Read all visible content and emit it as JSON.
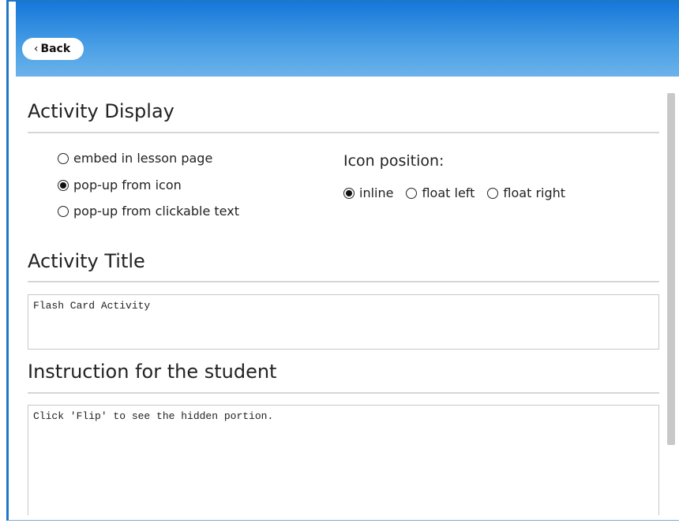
{
  "header": {
    "back_label": "Back"
  },
  "activity_display": {
    "title": "Activity Display",
    "options": [
      {
        "label": "embed in lesson page",
        "checked": false
      },
      {
        "label": "pop-up from icon",
        "checked": true
      },
      {
        "label": "pop-up from clickable text",
        "checked": false
      }
    ]
  },
  "icon_position": {
    "label": "Icon position:",
    "options": [
      {
        "label": "inline",
        "checked": true
      },
      {
        "label": "float left",
        "checked": false
      },
      {
        "label": "float right",
        "checked": false
      }
    ]
  },
  "activity_title": {
    "title": "Activity Title",
    "value": "Flash Card Activity"
  },
  "instruction": {
    "title": "Instruction for the student",
    "value": "Click 'Flip' to see the hidden portion."
  },
  "colors": {
    "header_top": "#1577d9",
    "header_bottom": "#6cb2ea",
    "frame_border": "#1f76c7"
  }
}
